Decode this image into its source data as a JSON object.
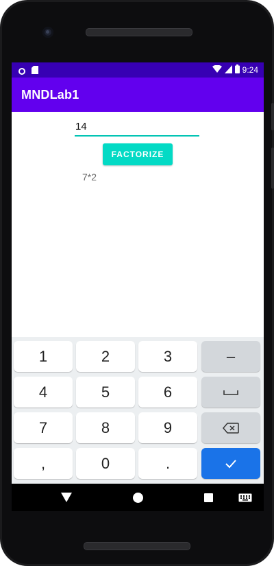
{
  "status_bar": {
    "time": "9:24",
    "icons": [
      "notification-circle-icon",
      "sd-card-icon",
      "wifi-icon",
      "cell-signal-icon",
      "battery-icon"
    ]
  },
  "app_bar": {
    "title": "MNDLab1",
    "color": "#6200ee"
  },
  "form": {
    "input_value": "14",
    "button_label": "FACTORIZE",
    "result_text": "7*2",
    "accent": "#03dac5"
  },
  "keyboard": {
    "rows": [
      [
        "1",
        "2",
        "3",
        "–"
      ],
      [
        "4",
        "5",
        "6",
        "space"
      ],
      [
        "7",
        "8",
        "9",
        "backspace"
      ],
      [
        ",",
        "0",
        ".",
        "done"
      ]
    ],
    "enter_color": "#1a73e8"
  },
  "nav_bar": {
    "buttons": [
      "back-icon",
      "home-icon",
      "recents-icon",
      "keyboard-switch-icon"
    ]
  }
}
